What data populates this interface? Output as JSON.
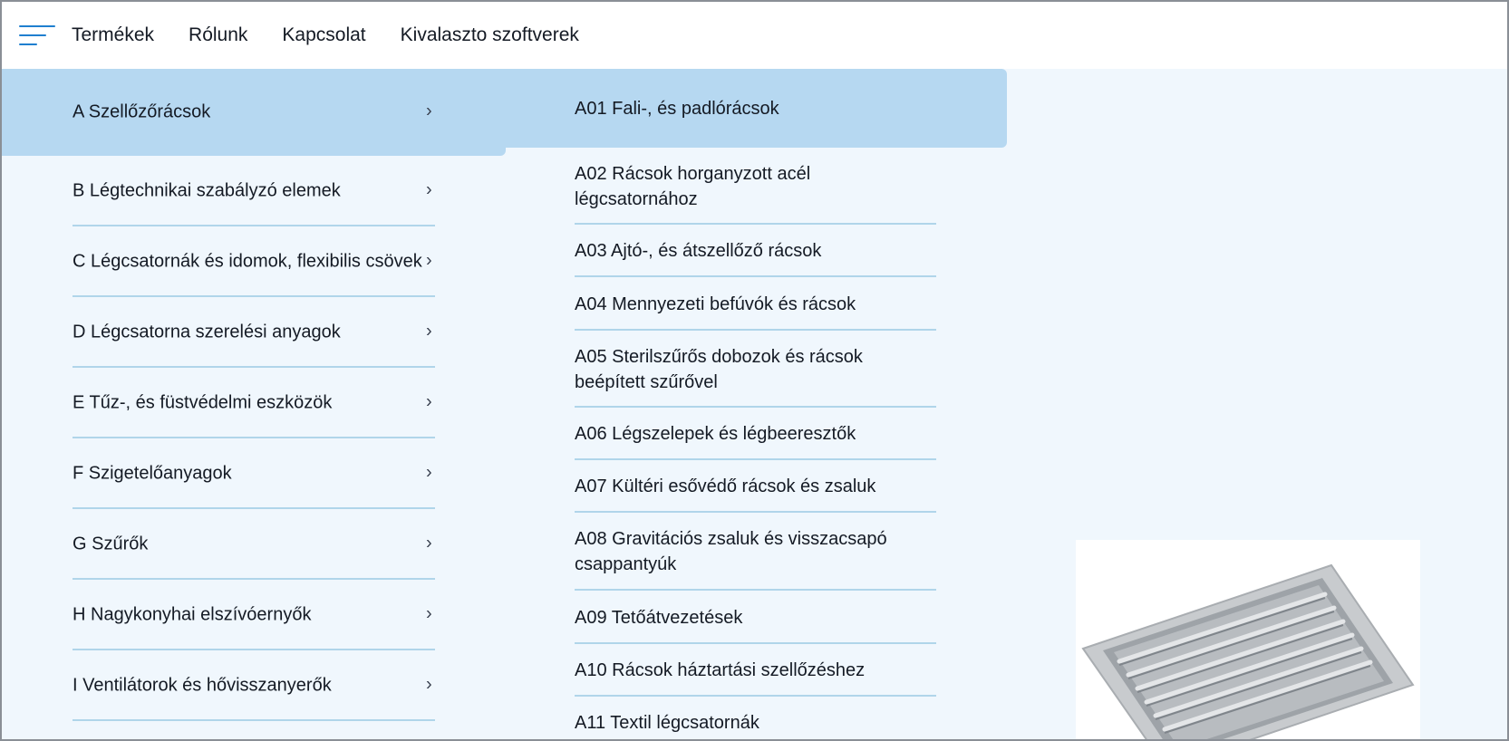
{
  "nav": {
    "links": [
      "Termékek",
      "Rólunk",
      "Kapcsolat",
      "Kivalaszto szoftverek"
    ]
  },
  "categories": [
    {
      "label": "A Szellőzőrácsok",
      "active": true
    },
    {
      "label": "B Légtechnikai szabályzó elemek"
    },
    {
      "label": "C Légcsatornák és idomok, flexibilis csövek"
    },
    {
      "label": "D Légcsatorna szerelési anyagok"
    },
    {
      "label": "E Tűz-, és füstvédelmi eszközök"
    },
    {
      "label": "F Szigetelőanyagok"
    },
    {
      "label": "G Szűrők"
    },
    {
      "label": "H Nagykonyhai elszívóernyők"
    },
    {
      "label": "I Ventilátorok és hővisszanyerők"
    }
  ],
  "subcategories": [
    {
      "label": "A01 Fali-, és padlórácsok",
      "active": true
    },
    {
      "label": "A02 Rácsok horganyzott acél légcsatornához"
    },
    {
      "label": "A03 Ajtó-, és átszellőző rácsok"
    },
    {
      "label": "A04 Mennyezeti befúvók és rácsok"
    },
    {
      "label": "A05 Sterilszűrős dobozok és rácsok beépített szűrővel"
    },
    {
      "label": "A06 Légszelepek és légbeeresztők"
    },
    {
      "label": "A07 Kültéri esővédő rácsok és zsaluk"
    },
    {
      "label": "A08 Gravitációs zsaluk és visszacsapó csappantyúk"
    },
    {
      "label": "A09 Tetőátvezetések"
    },
    {
      "label": "A10 Rácsok háztartási szellőzéshez"
    },
    {
      "label": "A11 Textil légcsatornák"
    }
  ],
  "colors": {
    "accent": "#1f7fcf",
    "highlight": "#b6d8f1",
    "panel": "#f0f7fd",
    "separator": "#b0d5ea"
  },
  "icons": {
    "menu": "hamburger-icon",
    "chevron": "chevron-right-icon"
  }
}
